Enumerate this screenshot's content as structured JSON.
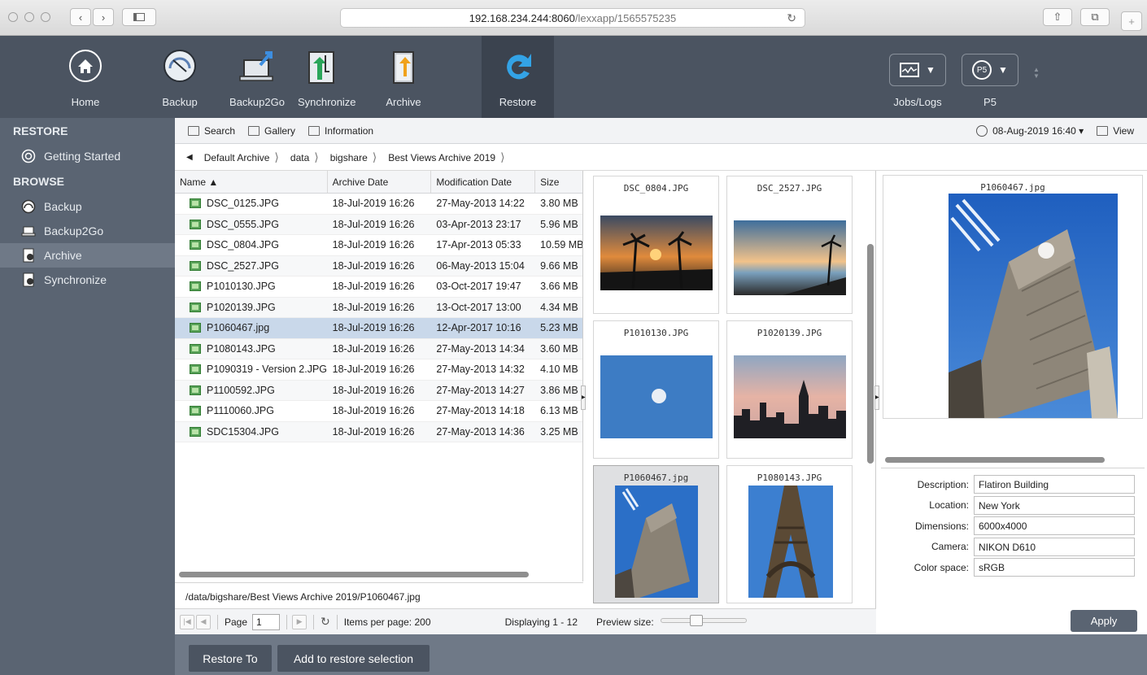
{
  "browser": {
    "url_host": "192.168.234.244:8060",
    "url_path": "/lexxapp/1565575235"
  },
  "toolbar": {
    "home": "Home",
    "backup": "Backup",
    "backup2go": "Backup2Go",
    "synchronize": "Synchronize",
    "archive": "Archive",
    "restore": "Restore",
    "jobs_logs": "Jobs/Logs",
    "p5": "P5",
    "p5_badge": "P5"
  },
  "sidebar": {
    "restore_header": "RESTORE",
    "getting_started": "Getting Started",
    "browse_header": "BROWSE",
    "items": [
      "Backup",
      "Backup2Go",
      "Archive",
      "Synchronize"
    ]
  },
  "subbar": {
    "search": "Search",
    "gallery": "Gallery",
    "information": "Information",
    "date": "08-Aug-2019 16:40 ▾",
    "view": "View"
  },
  "breadcrumb": [
    "Default Archive",
    "data",
    "bigshare",
    "Best Views Archive 2019"
  ],
  "table": {
    "headers": [
      "Name ▲",
      "Archive Date",
      "Modification Date",
      "Size"
    ],
    "rows": [
      [
        "DSC_0125.JPG",
        "18-Jul-2019 16:26",
        "27-May-2013 14:22",
        "3.80 MB"
      ],
      [
        "DSC_0555.JPG",
        "18-Jul-2019 16:26",
        "03-Apr-2013 23:17",
        "5.96 MB"
      ],
      [
        "DSC_0804.JPG",
        "18-Jul-2019 16:26",
        "17-Apr-2013 05:33",
        "10.59 MB"
      ],
      [
        "DSC_2527.JPG",
        "18-Jul-2019 16:26",
        "06-May-2013 15:04",
        "9.66 MB"
      ],
      [
        "P1010130.JPG",
        "18-Jul-2019 16:26",
        "03-Oct-2017 19:47",
        "3.66 MB"
      ],
      [
        "P1020139.JPG",
        "18-Jul-2019 16:26",
        "13-Oct-2017 13:00",
        "4.34 MB"
      ],
      [
        "P1060467.jpg",
        "18-Jul-2019 16:26",
        "12-Apr-2017 10:16",
        "5.23 MB"
      ],
      [
        "P1080143.JPG",
        "18-Jul-2019 16:26",
        "27-May-2013 14:34",
        "3.60 MB"
      ],
      [
        "P1090319 - Version 2.JPG",
        "18-Jul-2019 16:26",
        "27-May-2013 14:32",
        "4.10 MB"
      ],
      [
        "P1100592.JPG",
        "18-Jul-2019 16:26",
        "27-May-2013 14:27",
        "3.86 MB"
      ],
      [
        "P1110060.JPG",
        "18-Jul-2019 16:26",
        "27-May-2013 14:18",
        "6.13 MB"
      ],
      [
        "SDC15304.JPG",
        "18-Jul-2019 16:26",
        "27-May-2013 14:36",
        "3.25 MB"
      ]
    ]
  },
  "path": "/data/bigshare/Best Views Archive 2019/P1060467.jpg",
  "pager": {
    "page_label": "Page",
    "page_value": "1",
    "items_per_page": "Items per page: 200",
    "displaying": "Displaying 1 - 12"
  },
  "gallery": {
    "tiles": [
      "DSC_0804.JPG",
      "DSC_2527.JPG",
      "P1010130.JPG",
      "P1020139.JPG",
      "P1060467.jpg",
      "P1080143.JPG"
    ],
    "preview_size_label": "Preview size:",
    "preview_size_level": 0.4
  },
  "preview": {
    "filename": "P1060467.jpg",
    "fields": [
      {
        "label": "Description:",
        "value": "Flatiron Building"
      },
      {
        "label": "Location:",
        "value": "New York"
      },
      {
        "label": "Dimensions:",
        "value": "6000x4000"
      },
      {
        "label": "Camera:",
        "value": "NIKON D610"
      },
      {
        "label": "Color space:",
        "value": "sRGB"
      }
    ],
    "apply": "Apply"
  },
  "bottom": {
    "restore_to": "Restore To",
    "add_to_selection": "Add to restore selection"
  }
}
